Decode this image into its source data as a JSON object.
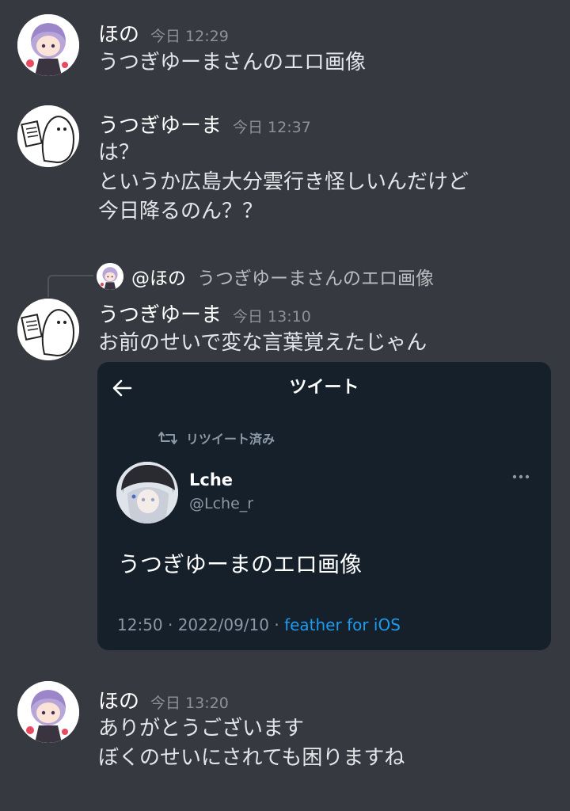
{
  "messages": [
    {
      "author": "ほの",
      "time": "今日 12:29",
      "lines": [
        "うつぎゆーまさんのエロ画像"
      ]
    },
    {
      "author": "うつぎゆーま",
      "time": "今日 12:37",
      "lines": [
        "は？",
        "というか広島大分雲行き怪しいんだけど",
        "今日降るのん？？"
      ]
    },
    {
      "author": "うつぎゆーま",
      "time": "今日 13:10",
      "reply": {
        "author": "@ほの",
        "text": "うつぎゆーまさんのエロ画像"
      },
      "lines": [
        "お前のせいで変な言葉覚えたじゃん"
      ],
      "embed": {
        "header_title": "ツイート",
        "retweet_label": "リツイート済み",
        "tweet_author_name": "Lche",
        "tweet_author_handle": "@Lche_r",
        "tweet_text": "うつぎゆーまのエロ画像",
        "tweet_meta": "12:50 · 2022/09/10 · ",
        "tweet_client": "feather for iOS"
      }
    },
    {
      "author": "ほの",
      "time": "今日 13:20",
      "lines": [
        "ありがとうございます",
        "ぼくのせいにされても困りますね"
      ]
    }
  ],
  "icons": {
    "back": "arrow-left-icon",
    "retweet": "retweet-icon",
    "more": "more-horizontal-icon"
  },
  "colors": {
    "background": "#36393f",
    "embed_background": "#15202b",
    "link": "#1d9bf0",
    "muted": "#8e9297"
  }
}
